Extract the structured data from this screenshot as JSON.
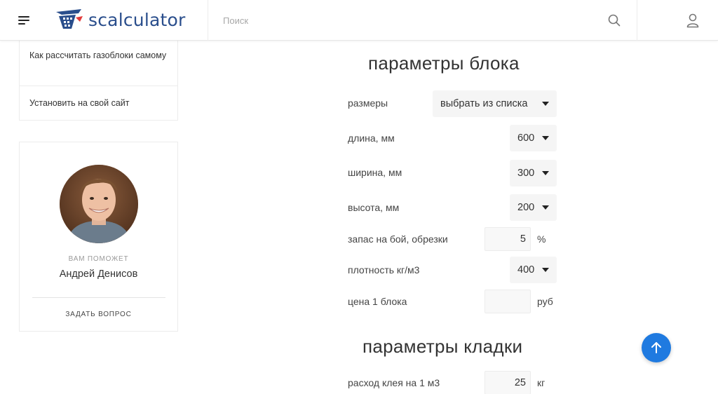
{
  "header": {
    "logo_text": "scalculator",
    "search_placeholder": "Поиск",
    "icons": {
      "menu": "hamburger-icon",
      "search": "search-icon",
      "user": "user-icon"
    },
    "brand_color": "#2a4e8c"
  },
  "sidebar": {
    "menu_items": [
      {
        "label": "Как рассчитать газоблоки самому"
      },
      {
        "label": "Установить на свой сайт"
      }
    ],
    "expert": {
      "helper_label": "ВАМ ПОМОЖЕТ",
      "name": "Андрей Денисов",
      "ask_button": "ЗАДАТЬ ВОПРОС"
    }
  },
  "block_params": {
    "title": "параметры блока",
    "sizes": {
      "label": "размеры",
      "value": "выбрать из списка"
    },
    "length": {
      "label": "длина, мм",
      "value": "600"
    },
    "width": {
      "label": "ширина, мм",
      "value": "300"
    },
    "height": {
      "label": "высота, мм",
      "value": "200"
    },
    "reserve": {
      "label": "запас на бой, обрезки",
      "value": "5",
      "unit": "%"
    },
    "density": {
      "label": "плотность кг/м3",
      "value": "400"
    },
    "price": {
      "label": "цена 1 блока",
      "value": "",
      "unit": "руб"
    }
  },
  "masonry_params": {
    "title": "параметры кладки",
    "glue": {
      "label": "расход клея на 1 м3",
      "value": "25",
      "unit": "кг"
    }
  },
  "accent_color": "#1f7ae0"
}
